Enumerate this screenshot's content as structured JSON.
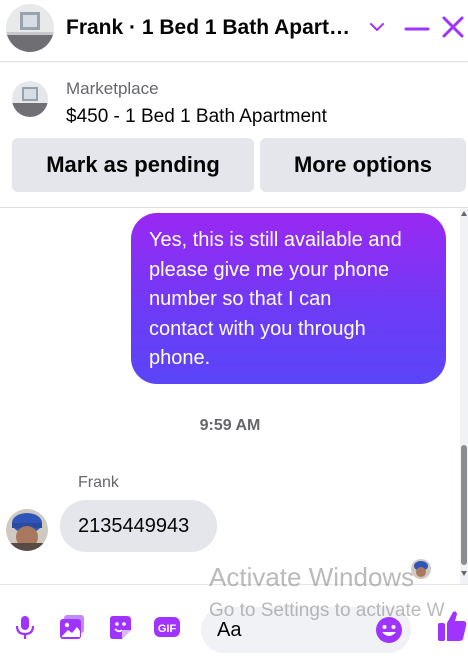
{
  "header": {
    "title": "Frank · 1 Bed 1 Bath Apart…",
    "icons": [
      "listing-photo-avatar",
      "chevron-down-icon",
      "minimize-icon",
      "close-icon"
    ],
    "accent_color": "#a033ff"
  },
  "marketplace": {
    "label": "Marketplace",
    "listing_title": "$450 - 1 Bed 1 Bath Apartment",
    "mark_pending_label": "Mark as pending",
    "more_options_label": "More options"
  },
  "messages": {
    "outgoing_text": "Yes, this is still available and please give me your phone number so that I can contact with you through phone.",
    "outgoing_lines": [
      "Yes, this is still available and",
      "please give me your phone",
      "number so that I can",
      "contact with you through",
      "phone."
    ],
    "timestamp": "9:59 AM",
    "incoming_sender": "Frank",
    "incoming_text": "2135449943",
    "outgoing_gradient": [
      "#9a28f2",
      "#5a45f8"
    ]
  },
  "composer": {
    "placeholder": "Aa",
    "icons": [
      "microphone-icon",
      "photo-icon",
      "sticker-icon",
      "gif-icon",
      "emoji-icon",
      "thumbs-up-icon"
    ],
    "gif_label": "GIF"
  },
  "watermark": {
    "title": "Activate Windows",
    "subtitle": "Go to Settings to activate W"
  }
}
